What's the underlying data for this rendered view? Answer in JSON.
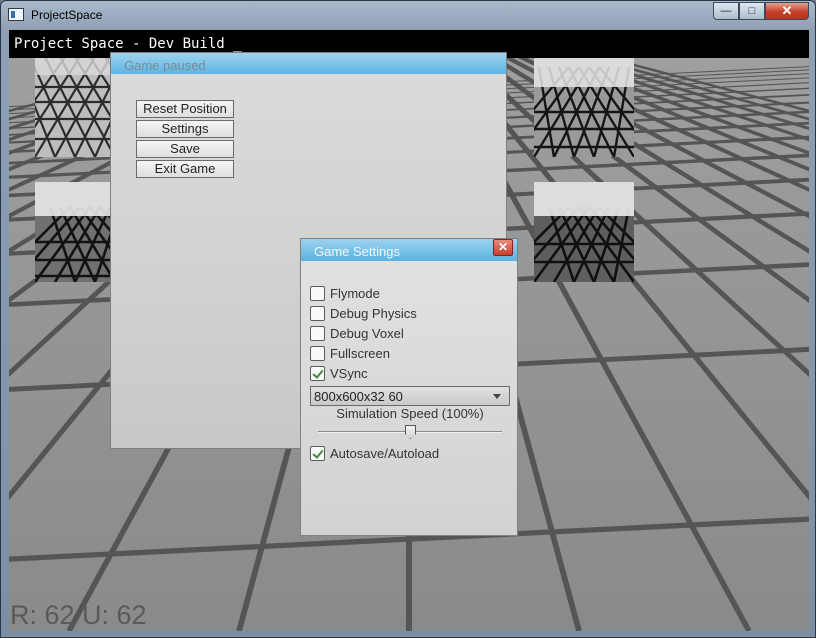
{
  "window": {
    "title": "ProjectSpace",
    "min_label": "—",
    "max_label": "□",
    "close_label": "✕"
  },
  "hud": {
    "dev_banner": "Project Space - Dev Build _",
    "counters": "R: 62 U: 62"
  },
  "paused_menu": {
    "title": "Game paused",
    "buttons": [
      "Reset Position",
      "Settings",
      "Save",
      "Exit Game"
    ]
  },
  "settings": {
    "title": "Game Settings",
    "close_label": "✕",
    "options": [
      {
        "label": "Flymode",
        "checked": false
      },
      {
        "label": "Debug Physics",
        "checked": false
      },
      {
        "label": "Debug Voxel",
        "checked": false
      },
      {
        "label": "Fullscreen",
        "checked": false
      },
      {
        "label": "VSync",
        "checked": true
      }
    ],
    "resolution": "800x600x32 60",
    "simulation_label": "Simulation Speed (100%)",
    "simulation_value": 0.5,
    "autosave": {
      "label": "Autosave/Autoload",
      "checked": true
    }
  },
  "colors": {
    "header_accent": "#5cb6e3",
    "close_red": "#c63d27",
    "check_green": "#3c8a3c"
  }
}
